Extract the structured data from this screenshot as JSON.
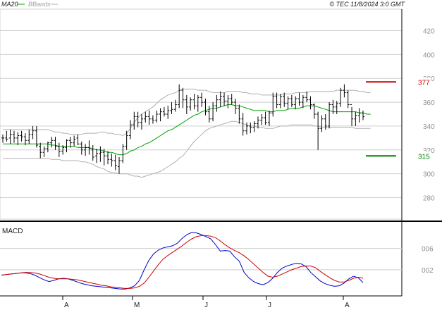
{
  "header": {
    "legend_ma": "MA20",
    "legend_bb": "BBands",
    "copyright": "© TEC 11/8/2024 3:0 GMT"
  },
  "colors": {
    "price_bars": "#000000",
    "ma": "#00a000",
    "bbands": "#b0b0b0",
    "resistance": "#d00000",
    "support": "#008000",
    "macd": "#0000cc",
    "signal": "#d00000",
    "grid": "#cfcfcf"
  },
  "chart_data": [
    {
      "type": "bar",
      "subtype": "ohlc",
      "y_ticks": [
        280,
        300,
        320,
        340,
        360,
        380,
        400,
        420
      ],
      "y_tick_labels": [
        "280",
        "300",
        "320",
        "340",
        "360",
        "380",
        "400",
        "420"
      ],
      "ylim": [
        262,
        438
      ],
      "x_months": [
        "A",
        "M",
        "J",
        "J",
        "A"
      ],
      "levels": [
        {
          "name": "resistance",
          "value": 377,
          "label": "377"
        },
        {
          "name": "support",
          "value": 315,
          "label": "315"
        }
      ],
      "ohlc": [
        [
          330,
          333,
          326,
          330
        ],
        [
          330,
          336,
          327,
          329
        ],
        [
          330,
          337,
          325,
          333
        ],
        [
          333,
          336,
          326,
          330
        ],
        [
          330,
          335,
          324,
          332
        ],
        [
          332,
          336,
          327,
          331
        ],
        [
          331,
          334,
          324,
          328
        ],
        [
          328,
          337,
          325,
          333
        ],
        [
          333,
          340,
          329,
          336
        ],
        [
          336,
          340,
          322,
          324
        ],
        [
          323,
          326,
          313,
          318
        ],
        [
          318,
          323,
          314,
          321
        ],
        [
          321,
          327,
          318,
          326
        ],
        [
          326,
          331,
          322,
          328
        ],
        [
          328,
          331,
          320,
          323
        ],
        [
          323,
          326,
          314,
          319
        ],
        [
          319,
          324,
          316,
          322
        ],
        [
          322,
          329,
          318,
          328
        ],
        [
          328,
          331,
          322,
          326
        ],
        [
          326,
          332,
          323,
          329
        ],
        [
          330,
          333,
          324,
          325
        ],
        [
          325,
          327,
          316,
          320
        ],
        [
          320,
          325,
          315,
          322
        ],
        [
          322,
          328,
          316,
          321
        ],
        [
          320,
          324,
          311,
          314
        ],
        [
          315,
          321,
          309,
          317
        ],
        [
          317,
          323,
          310,
          318
        ],
        [
          318,
          321,
          307,
          315
        ],
        [
          315,
          319,
          308,
          312
        ],
        [
          312,
          317,
          306,
          311
        ],
        [
          311,
          316,
          303,
          307
        ],
        [
          306,
          314,
          300,
          311
        ],
        [
          311,
          325,
          309,
          323
        ],
        [
          323,
          336,
          320,
          332
        ],
        [
          332,
          345,
          329,
          341
        ],
        [
          341,
          352,
          337,
          348
        ],
        [
          348,
          352,
          339,
          343
        ],
        [
          343,
          350,
          337,
          346
        ],
        [
          346,
          352,
          343,
          348
        ],
        [
          348,
          353,
          341,
          346
        ],
        [
          346,
          349,
          342,
          345
        ],
        [
          345,
          353,
          343,
          350
        ],
        [
          350,
          355,
          344,
          352
        ],
        [
          352,
          356,
          348,
          350
        ],
        [
          350,
          357,
          346,
          353
        ],
        [
          353,
          360,
          350,
          354
        ],
        [
          354,
          362,
          352,
          358
        ],
        [
          358,
          375,
          355,
          370
        ],
        [
          370,
          372,
          355,
          362
        ],
        [
          362,
          366,
          350,
          356
        ],
        [
          356,
          364,
          353,
          362
        ],
        [
          362,
          367,
          354,
          357
        ],
        [
          357,
          366,
          352,
          364
        ],
        [
          364,
          368,
          356,
          360
        ],
        [
          360,
          363,
          349,
          352
        ],
        [
          352,
          357,
          343,
          346
        ],
        [
          346,
          360,
          344,
          357
        ],
        [
          357,
          366,
          352,
          362
        ],
        [
          362,
          369,
          356,
          365
        ],
        [
          365,
          368,
          357,
          361
        ],
        [
          361,
          366,
          355,
          363
        ],
        [
          363,
          367,
          358,
          360
        ],
        [
          360,
          363,
          350,
          355
        ],
        [
          355,
          358,
          342,
          346
        ],
        [
          346,
          351,
          332,
          336
        ],
        [
          336,
          343,
          333,
          340
        ],
        [
          340,
          343,
          334,
          339
        ],
        [
          339,
          344,
          335,
          342
        ],
        [
          342,
          348,
          338,
          345
        ],
        [
          345,
          350,
          341,
          347
        ],
        [
          347,
          352,
          341,
          343
        ],
        [
          343,
          353,
          340,
          351
        ],
        [
          351,
          368,
          348,
          365
        ],
        [
          365,
          368,
          355,
          358
        ],
        [
          358,
          367,
          355,
          365
        ],
        [
          365,
          368,
          356,
          359
        ],
        [
          359,
          365,
          354,
          363
        ],
        [
          363,
          366,
          356,
          358
        ],
        [
          358,
          365,
          354,
          363
        ],
        [
          363,
          368,
          357,
          360
        ],
        [
          360,
          366,
          355,
          364
        ],
        [
          364,
          369,
          360,
          362
        ],
        [
          362,
          365,
          354,
          358
        ],
        [
          358,
          359,
          346,
          350
        ],
        [
          350,
          352,
          320,
          338
        ],
        [
          338,
          349,
          335,
          346
        ],
        [
          346,
          350,
          337,
          340
        ],
        [
          340,
          360,
          338,
          358
        ],
        [
          358,
          362,
          350,
          356
        ],
        [
          356,
          361,
          350,
          359
        ],
        [
          359,
          372,
          356,
          370
        ],
        [
          370,
          375,
          364,
          368
        ],
        [
          368,
          370,
          355,
          358
        ],
        [
          358,
          356,
          340,
          346
        ],
        [
          346,
          352,
          340,
          349
        ],
        [
          349,
          355,
          343,
          351
        ],
        [
          351,
          353,
          345,
          348
        ]
      ],
      "ma20": [
        325,
        325,
        325,
        325,
        325,
        325,
        325,
        325,
        325,
        325,
        325,
        325,
        325,
        324,
        324,
        323,
        323,
        323,
        323,
        323,
        322,
        322,
        322,
        322,
        321,
        320,
        320,
        319,
        318,
        318,
        317,
        316,
        316,
        317,
        319,
        320,
        322,
        323,
        325,
        326,
        328,
        330,
        332,
        334,
        336,
        337,
        339,
        341,
        343,
        345,
        347,
        349,
        350,
        352,
        353,
        354,
        355,
        355,
        356,
        357,
        358,
        358,
        357,
        357,
        356,
        355,
        354,
        353,
        353,
        353,
        353,
        352,
        352,
        353,
        353,
        353,
        354,
        355,
        355,
        355,
        356,
        357,
        357,
        357,
        356,
        355,
        354,
        353,
        352,
        352,
        352,
        352,
        352,
        352,
        352,
        351,
        351,
        350,
        350
      ],
      "bb_upper": [
        337,
        337,
        337,
        337,
        337,
        337,
        337,
        337,
        337,
        337,
        337,
        337,
        337,
        336,
        335,
        335,
        334,
        334,
        333,
        333,
        333,
        333,
        334,
        334,
        334,
        334,
        335,
        335,
        334,
        334,
        333,
        333,
        332,
        334,
        338,
        343,
        347,
        350,
        352,
        354,
        356,
        359,
        362,
        364,
        366,
        367,
        368,
        370,
        371,
        371,
        371,
        371,
        370,
        370,
        370,
        369,
        368,
        368,
        368,
        368,
        369,
        369,
        369,
        369,
        368,
        368,
        367,
        367,
        367,
        366,
        366,
        366,
        366,
        366,
        366,
        367,
        367,
        367,
        368,
        368,
        368,
        368,
        369,
        369,
        369,
        369,
        369,
        369,
        369,
        370,
        370,
        370,
        370,
        370,
        370,
        369,
        369,
        368,
        368
      ],
      "bb_lower": [
        313,
        313,
        313,
        313,
        313,
        313,
        313,
        313,
        313,
        313,
        313,
        313,
        313,
        312,
        312,
        312,
        311,
        311,
        311,
        311,
        311,
        310,
        310,
        309,
        308,
        306,
        305,
        304,
        302,
        301,
        301,
        300,
        300,
        300,
        299,
        298,
        298,
        297,
        298,
        299,
        300,
        301,
        302,
        304,
        306,
        308,
        310,
        313,
        315,
        319,
        323,
        327,
        330,
        333,
        336,
        338,
        339,
        340,
        341,
        342,
        343,
        344,
        344,
        343,
        342,
        341,
        340,
        340,
        339,
        339,
        338,
        338,
        338,
        339,
        340,
        340,
        340,
        341,
        341,
        341,
        341,
        341,
        341,
        340,
        340,
        339,
        339,
        339,
        339,
        339,
        339,
        339,
        339,
        339,
        338,
        338,
        338,
        338,
        338
      ]
    },
    {
      "type": "line",
      "title": "MACD",
      "y_ticks": [
        0.02,
        0.06
      ],
      "y_tick_labels": [
        "002",
        "006"
      ],
      "ylim": [
        -0.029,
        0.107
      ],
      "series": [
        {
          "name": "macd",
          "values": [
            0.01,
            0.011,
            0.012,
            0.013,
            0.014,
            0.014,
            0.013,
            0.01,
            0.0055,
            0.001,
            -0.002,
            0.0,
            0.003,
            0.004,
            0.003,
            0.0,
            -0.003,
            -0.006,
            -0.008,
            -0.01,
            -0.011,
            -0.012,
            -0.013,
            -0.014,
            -0.015,
            -0.016,
            -0.016,
            -0.014,
            -0.01,
            0.0,
            0.02,
            0.038,
            0.05,
            0.057,
            0.061,
            0.063,
            0.065,
            0.07,
            0.079,
            0.086,
            0.09,
            0.089,
            0.086,
            0.082,
            0.078,
            0.067,
            0.055,
            0.056,
            0.055,
            0.044,
            0.036,
            0.015,
            0.005,
            -0.002,
            -0.006,
            -0.008,
            -0.004,
            0.004,
            0.015,
            0.023,
            0.027,
            0.03,
            0.032,
            0.031,
            0.026,
            0.015,
            0.007,
            -0.001,
            -0.006,
            -0.009,
            -0.011,
            -0.01,
            -0.005,
            0.003,
            0.008,
            0.005,
            -0.004
          ]
        },
        {
          "name": "signal",
          "values": [
            0.01,
            0.011,
            0.012,
            0.013,
            0.014,
            0.015,
            0.015,
            0.014,
            0.012,
            0.009,
            0.006,
            0.004,
            0.003,
            0.003,
            0.003,
            0.002,
            0.001,
            -0.001,
            -0.003,
            -0.005,
            -0.007,
            -0.009,
            -0.01,
            -0.012,
            -0.013,
            -0.014,
            -0.015,
            -0.015,
            -0.014,
            -0.011,
            -0.005,
            0.006,
            0.018,
            0.03,
            0.04,
            0.047,
            0.053,
            0.059,
            0.065,
            0.072,
            0.078,
            0.082,
            0.084,
            0.084,
            0.083,
            0.08,
            0.074,
            0.067,
            0.061,
            0.056,
            0.052,
            0.046,
            0.039,
            0.031,
            0.023,
            0.015,
            0.008,
            0.006,
            0.008,
            0.012,
            0.016,
            0.02,
            0.023,
            0.026,
            0.027,
            0.027,
            0.024,
            0.017,
            0.011,
            0.005,
            0.0,
            -0.003,
            -0.003,
            0.0,
            0.004,
            0.006,
            0.004
          ]
        }
      ]
    }
  ]
}
